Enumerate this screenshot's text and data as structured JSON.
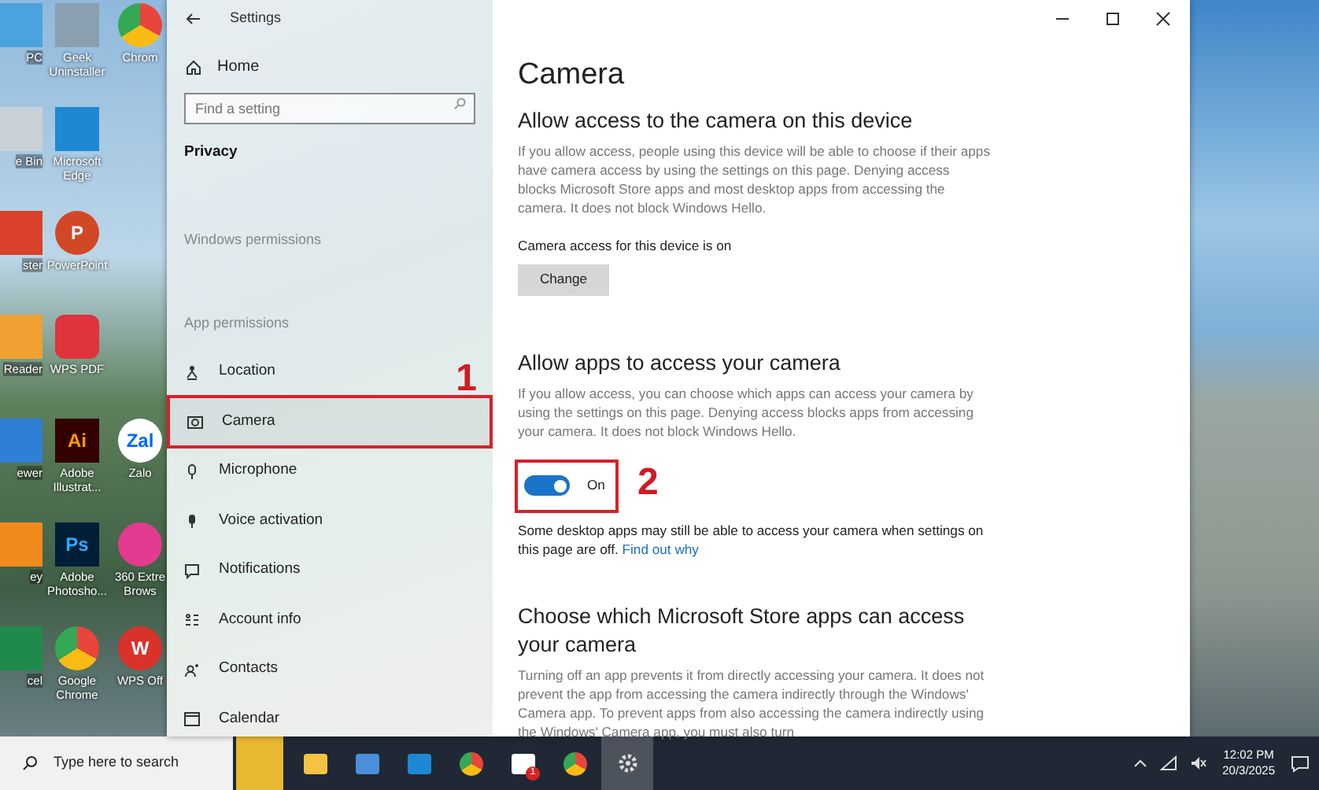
{
  "desktop": {
    "columns": [
      [
        {
          "kind": "pc",
          "label": "PC"
        },
        {
          "kind": "bin",
          "label": "e Bin"
        },
        {
          "kind": "c",
          "label": "ster"
        },
        {
          "kind": "reader",
          "label": "Reader"
        },
        {
          "kind": "viewer",
          "label": "ewer"
        },
        {
          "kind": "key",
          "label": "ey"
        },
        {
          "kind": "excel",
          "label": "cel"
        }
      ],
      [
        {
          "kind": "uninstaller",
          "label": "Geek Uninstaller"
        },
        {
          "kind": "edge",
          "label": "Microsoft Edge"
        },
        {
          "kind": "powerpoint",
          "label": "PowerPoint",
          "glyph": "P"
        },
        {
          "kind": "wpspdf",
          "label": "WPS PDF"
        },
        {
          "kind": "illustrator",
          "label": "Adobe Illustrat...",
          "glyph": "Ai"
        },
        {
          "kind": "photoshop",
          "label": "Adobe Photosho...",
          "glyph": "Ps"
        },
        {
          "kind": "chrome",
          "label": "Google Chrome"
        }
      ],
      [
        {
          "kind": "chrome",
          "label": "Chrom"
        },
        {
          "kind": "empty"
        },
        {
          "kind": "empty"
        },
        {
          "kind": "empty"
        },
        {
          "kind": "zalo",
          "label": "Zalo",
          "glyph": "Zal"
        },
        {
          "kind": "ring",
          "label": "360 Extre Brows"
        },
        {
          "kind": "wps",
          "label": "WPS Off",
          "glyph": "W"
        }
      ]
    ]
  },
  "window": {
    "title": "Settings"
  },
  "sidebar": {
    "home": "Home",
    "search_placeholder": "Find a setting",
    "heading": "Privacy",
    "groups": [
      {
        "label": "Windows permissions"
      },
      {
        "label": "App permissions",
        "items": [
          {
            "label": "Location",
            "selected": false,
            "highlighted": false
          },
          {
            "label": "Camera",
            "selected": true,
            "highlighted": true,
            "annotation": "1"
          },
          {
            "label": "Microphone",
            "selected": false,
            "highlighted": false
          },
          {
            "label": "Voice activation",
            "selected": false,
            "highlighted": false
          },
          {
            "label": "Notifications",
            "selected": false,
            "highlighted": false
          },
          {
            "label": "Account info",
            "selected": false,
            "highlighted": false
          },
          {
            "label": "Contacts",
            "selected": false,
            "highlighted": false
          },
          {
            "label": "Calendar",
            "selected": false,
            "highlighted": false
          }
        ]
      }
    ]
  },
  "content": {
    "title": "Camera",
    "sections": [
      {
        "kind": "button",
        "heading": "Allow access to the camera on this device",
        "description": "If you allow access, people using this device will be able to choose if their apps have camera access by using the settings on this page. Denying access blocks Microsoft Store apps and most desktop apps from accessing the camera. It does not block Windows Hello.",
        "status": "Camera access for this device is on",
        "button": "Change"
      },
      {
        "kind": "toggle",
        "heading": "Allow apps to access your camera",
        "description": "If you allow access, you can choose which apps can access your camera by using the settings on this page. Denying access blocks apps from accessing your camera. It does not block Windows Hello.",
        "toggle": {
          "on": true,
          "label": "On",
          "highlighted": true,
          "annotation": "2"
        },
        "note": "Some desktop apps may still be able to access your camera when settings on this page are off.",
        "link": "Find out why"
      },
      {
        "kind": "text",
        "heading": "Choose which Microsoft Store apps can access your camera",
        "description": "Turning off an app prevents it from directly accessing your camera. It does not prevent the app from accessing the camera indirectly through the Windows' Camera app. To prevent apps from also accessing the camera indirectly using the Windows' Camera app, you must also turn"
      }
    ]
  },
  "taskbar": {
    "search_placeholder": "Type here to search",
    "apps": [
      {
        "kind": "files",
        "active": false
      },
      {
        "kind": "store",
        "active": false
      },
      {
        "kind": "edge",
        "active": false
      },
      {
        "kind": "chrome",
        "active": false
      },
      {
        "kind": "mail",
        "active": false,
        "badge": "1"
      },
      {
        "kind": "chrome",
        "active": false
      },
      {
        "kind": "settings",
        "active": true
      }
    ],
    "time": "12:02 PM",
    "date": "20/3/2025"
  }
}
